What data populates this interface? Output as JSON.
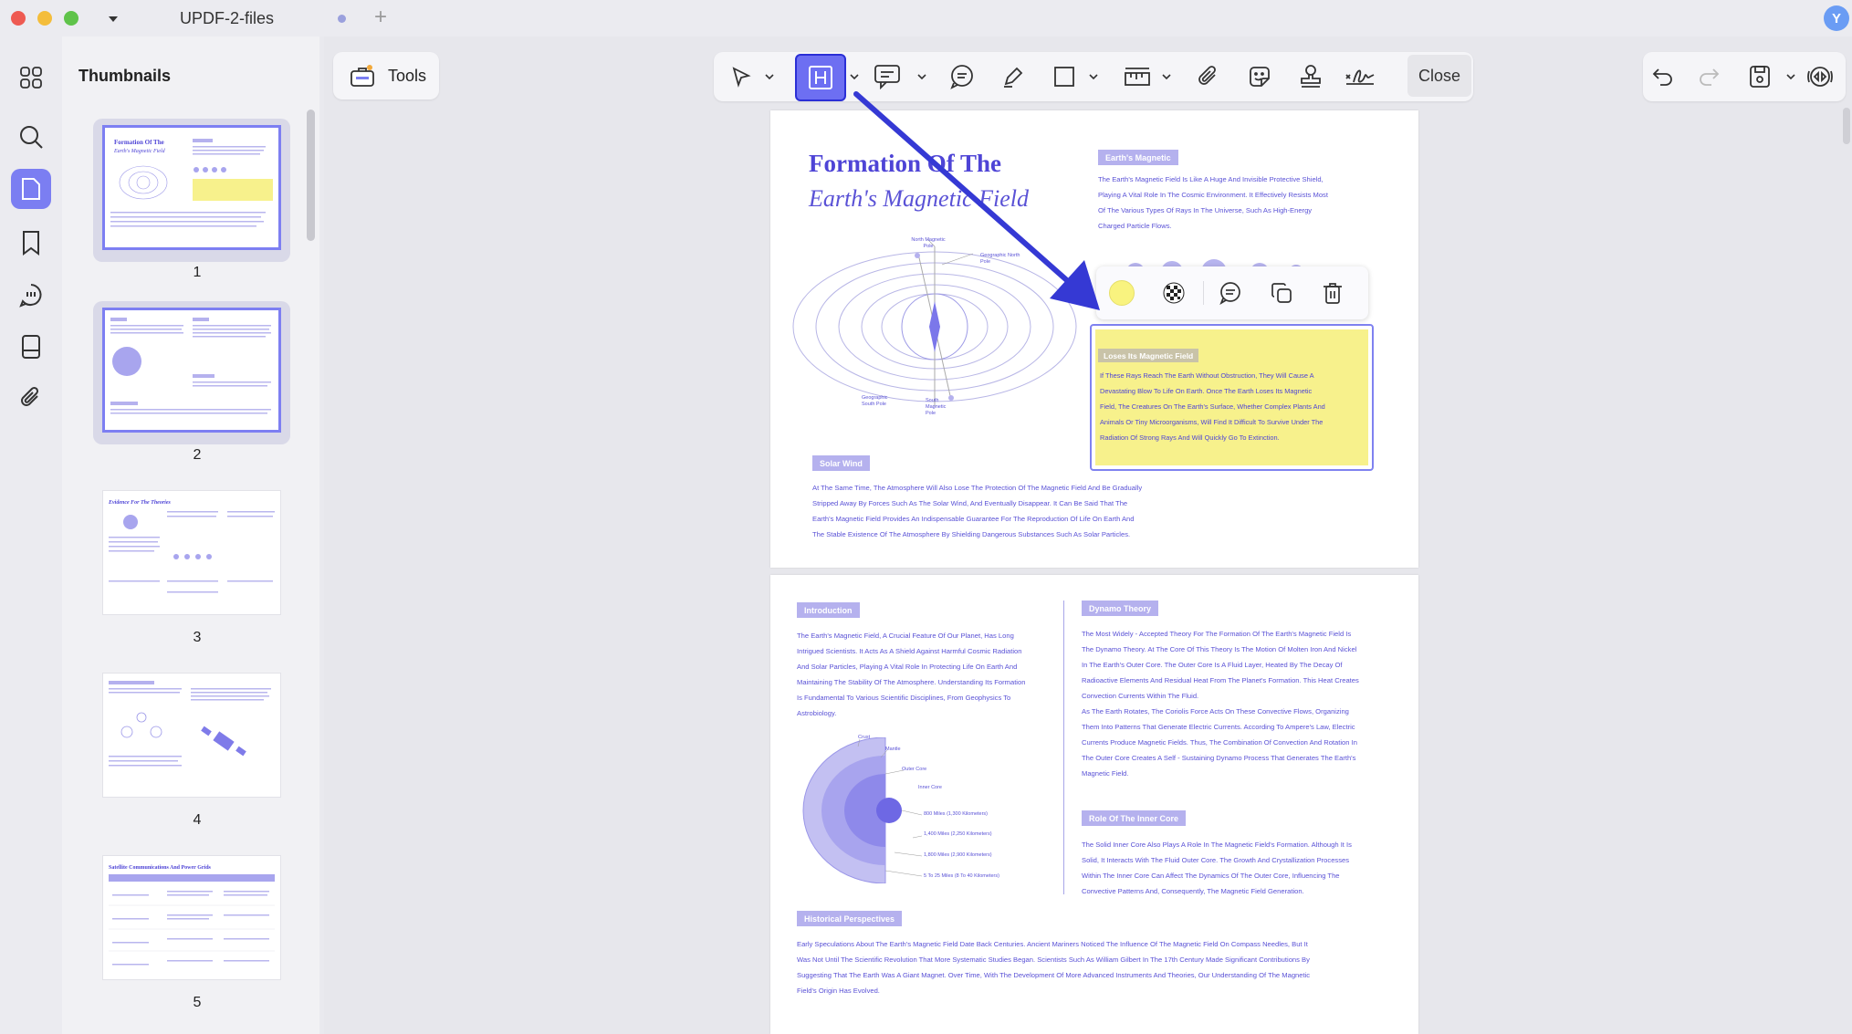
{
  "window": {
    "tab_title": "UPDF-2-files",
    "avatar_letter": "Y"
  },
  "sidebar": {
    "title": "Thumbnails",
    "pages": [
      "1",
      "2",
      "3",
      "4",
      "5"
    ]
  },
  "toolbar": {
    "tools_label": "Tools",
    "close_label": "Close"
  },
  "page1": {
    "title": "Formation Of The",
    "subtitle": "Earth's Magnetic Field",
    "magnetic_tag": "Earth's Magnetic",
    "magnetic_text": [
      "The Earth's Magnetic Field Is Like A Huge And Invisible Protective Shield,",
      "Playing A Vital Role In The Cosmic Environment. It Effectively Resists Most",
      "Of The Various Types Of Rays In The Universe, Such As High-Energy",
      "Charged Particle Flows."
    ],
    "diagram_labels": {
      "north_magnetic": "North Magnetic Pole",
      "north_geo": "Geographic North Pole",
      "south_geo": "Geographic South Pole",
      "south_magnetic": "South Magnetic Pole"
    },
    "highlight_tag": "Loses Its Magnetic Field",
    "highlight_text": [
      "If These Rays Reach The Earth Without Obstruction, They Will Cause A",
      "Devastating Blow To Life On Earth. Once The Earth Loses Its Magnetic",
      "Field, The Creatures On The Earth's Surface, Whether Complex Plants And",
      "Animals Or Tiny Microorganisms, Will Find It Difficult To Survive Under The",
      "Radiation Of Strong Rays And Will Quickly Go To Extinction."
    ],
    "solar_tag": "Solar Wind",
    "solar_text": [
      "At The Same Time, The Atmosphere Will Also Lose The Protection Of The Magnetic Field And Be Gradually",
      "Stripped Away By Forces Such As The Solar Wind, And Eventually Disappear. It Can Be Said That The",
      "Earth's Magnetic Field Provides An Indispensable Guarantee For The Reproduction Of Life On Earth And",
      "The Stable Existence Of The Atmosphere By Shielding Dangerous Substances Such As Solar Particles."
    ]
  },
  "page2": {
    "intro_tag": "Introduction",
    "intro_text": [
      "The Earth's Magnetic Field, A Crucial Feature Of Our Planet, Has Long",
      "Intrigued Scientists. It Acts As A Shield Against Harmful Cosmic Radiation",
      "And Solar Particles, Playing A Vital Role In Protecting Life On Earth And",
      "Maintaining The Stability Of The Atmosphere. Understanding Its Formation",
      "Is Fundamental To Various Scientific Disciplines, From Geophysics To",
      "Astrobiology."
    ],
    "dynamo_tag": "Dynamo Theory",
    "dynamo_text": [
      "The Most Widely - Accepted Theory For The Formation Of The Earth's Magnetic Field Is",
      "The Dynamo Theory. At The Core Of This Theory Is The Motion Of Molten Iron And Nickel",
      "In The Earth's Outer Core. The Outer Core Is A Fluid Layer, Heated By The Decay Of",
      "Radioactive Elements And Residual Heat From The Planet's Formation. This Heat Creates",
      "Convection Currents Within The Fluid.",
      "As The Earth Rotates, The Coriolis Force Acts On These Convective Flows, Organizing",
      "Them Into Patterns That Generate Electric Currents. According To Ampere's Law, Electric",
      "Currents Produce Magnetic Fields. Thus, The Combination Of Convection And Rotation In",
      "The Outer Core Creates A Self - Sustaining Dynamo Process That Generates The Earth's",
      "Magnetic Field."
    ],
    "core_labels": {
      "crust": "Crust",
      "mantle": "Mantle",
      "outer_core": "Outer Core",
      "inner_core": "Inner Core",
      "d1": "800 Miles (1,300 Kilometers)",
      "d2": "1,400 Miles (2,250 Kilometers)",
      "d3": "1,800 Miles (2,900 Kilometers)",
      "d4": "5 To 25 Miles (8 To 40 Kilometers)"
    },
    "inner_tag": "Role Of The Inner Core",
    "inner_text": [
      "The Solid Inner Core Also Plays A Role In The Magnetic Field's Formation. Although It Is",
      "Solid, It Interacts With The Fluid Outer Core. The Growth And Crystallization Processes",
      "Within The Inner Core Can Affect The Dynamics Of The Outer Core, Influencing The",
      "Convective Patterns And, Consequently, The Magnetic Field Generation."
    ],
    "history_tag": "Historical Perspectives",
    "history_text": [
      "Early Speculations About The Earth's Magnetic Field Date Back Centuries. Ancient Mariners Noticed The Influence Of The Magnetic Field On Compass Needles, But It",
      "Was Not Until The Scientific Revolution That More Systematic Studies Began. Scientists Such As William Gilbert In The 17th Century Made Significant Contributions By",
      "Suggesting That The Earth Was A Giant Magnet. Over Time, With The Development Of More Advanced Instruments And Theories, Our Understanding Of The Magnetic",
      "Field's Origin Has Evolved."
    ]
  },
  "colors": {
    "accent": "#6d6ff2",
    "highlight": "#f7f18c",
    "doc_text": "#5a52d6"
  }
}
